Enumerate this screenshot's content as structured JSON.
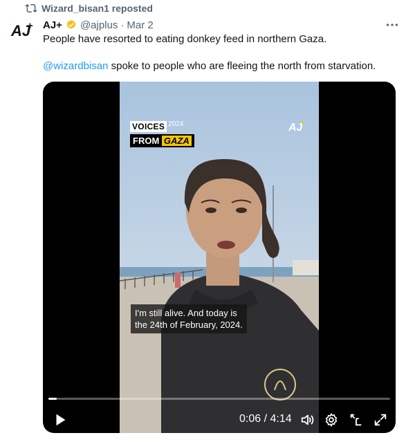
{
  "repost": {
    "text": "Wizard_bisan1 reposted",
    "icon": "repost-icon"
  },
  "author": {
    "name": "AJ+",
    "handle": "@ajplus",
    "separator": "·",
    "date": "Mar 2",
    "verified_color": "#f4c21d",
    "avatar_text": "AJ+"
  },
  "tweet": {
    "line1": "People have resorted to eating donkey feed in northern Gaza.",
    "mention": "@wizardbisan",
    "line2_rest": " spoke to people who are fleeing the north from starvation."
  },
  "video": {
    "badge_line1": "VOICES",
    "badge_year": "2024",
    "badge_from": "FROM",
    "badge_gaza": "GAZA",
    "watermark": "AJ+",
    "caption_line1": "I'm still alive. And today is",
    "caption_line2": "the 24th of February, 2024.",
    "time": "0:06 / 4:14",
    "progress_fraction": 0.024
  },
  "colors": {
    "accent": "#1d9bf0",
    "muted": "#536471",
    "text": "#0f1419"
  }
}
